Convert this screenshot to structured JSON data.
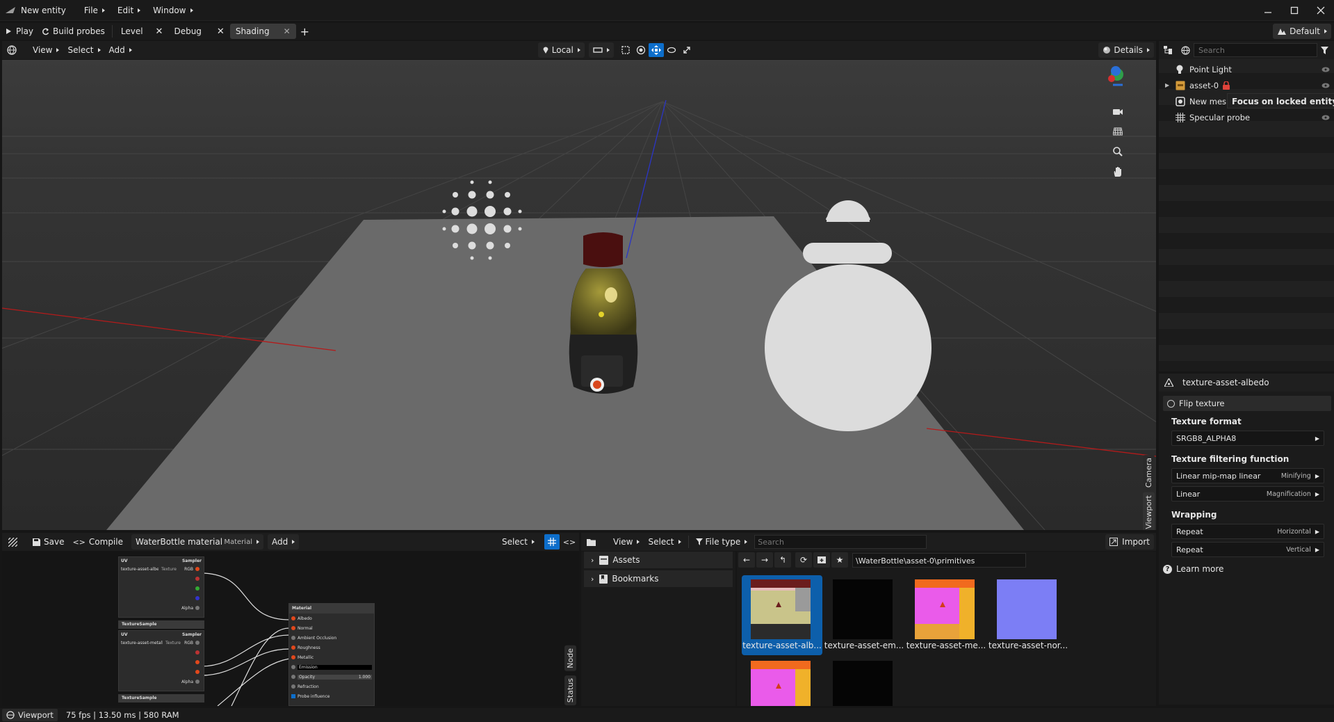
{
  "title": {
    "app_name": "New entity",
    "menus": [
      "File",
      "Edit",
      "Window"
    ]
  },
  "tabbar": {
    "play": "Play",
    "build_probes": "Build probes",
    "tabs": [
      "Level",
      "Debug",
      "Shading"
    ],
    "add": "+",
    "layout": "Default"
  },
  "scene_toolbar": {
    "menus": [
      "View",
      "Select",
      "Add"
    ],
    "space": "Local",
    "details": "Details"
  },
  "hierarchy": {
    "search_placeholder": "Search",
    "items": [
      "Point Light",
      "asset-0",
      "New mesh (",
      "Specular probe"
    ],
    "tooltip": "Focus on locked entity"
  },
  "inspector": {
    "title": "texture-asset-albedo",
    "flip_texture": "Flip texture",
    "texture_format_label": "Texture format",
    "texture_format_value": "SRGB8_ALPHA8",
    "filtering_label": "Texture filtering function",
    "minifying_value": "Linear mip-map linear",
    "minifying_sub": "Minifying",
    "magnification_value": "Linear",
    "magnification_sub": "Magnification",
    "wrapping_label": "Wrapping",
    "horizontal_value": "Repeat",
    "horizontal_sub": "Horizontal",
    "vertical_value": "Repeat",
    "vertical_sub": "Vertical",
    "learn_more": "Learn more"
  },
  "viewport_side_tabs": [
    "Camera",
    "Viewport"
  ],
  "shader": {
    "save": "Save",
    "compile": "Compile",
    "material_name": "WaterBottle material",
    "material_type": "Material",
    "add": "Add",
    "select": "Select",
    "side_tabs": [
      "Node",
      "Status"
    ],
    "nodes": {
      "uv1": "UV",
      "sampler1": "Sampler",
      "tex1": "texture-asset-albedo",
      "tex1_type": "Texture",
      "rgb1": "RGB",
      "alpha1": "Alpha",
      "texsample1": "TextureSample",
      "uv2": "UV",
      "sampler2": "Sampler",
      "tex2": "texture-asset-metallic...",
      "tex2_type": "Texture",
      "rgb2": "RGB",
      "alpha2": "Alpha",
      "texsample2": "TextureSample",
      "material": "Material",
      "inputs": [
        "Albedo",
        "Normal",
        "Ambient Occlusion",
        "Roughness",
        "Metallic",
        "Emission",
        "Opacity",
        "Refraction",
        "Probe influence"
      ],
      "opacity_value": "1.000"
    }
  },
  "assets": {
    "menus": [
      "View",
      "Select"
    ],
    "file_type": "File type",
    "search_placeholder": "Search",
    "import": "Import",
    "tree": [
      "Assets",
      "Bookmarks"
    ],
    "path": "\\WaterBottle\\asset-0\\primitives",
    "files": [
      "texture-asset-alb...",
      "texture-asset-em...",
      "texture-asset-me...",
      "texture-asset-nor..."
    ]
  },
  "status": {
    "view": "Viewport",
    "stats": "75 fps | 13.50 ms | 580 RAM"
  },
  "colors": {
    "accent": "#0d6ecb",
    "lock": "#e0433a",
    "background": "#161616"
  }
}
